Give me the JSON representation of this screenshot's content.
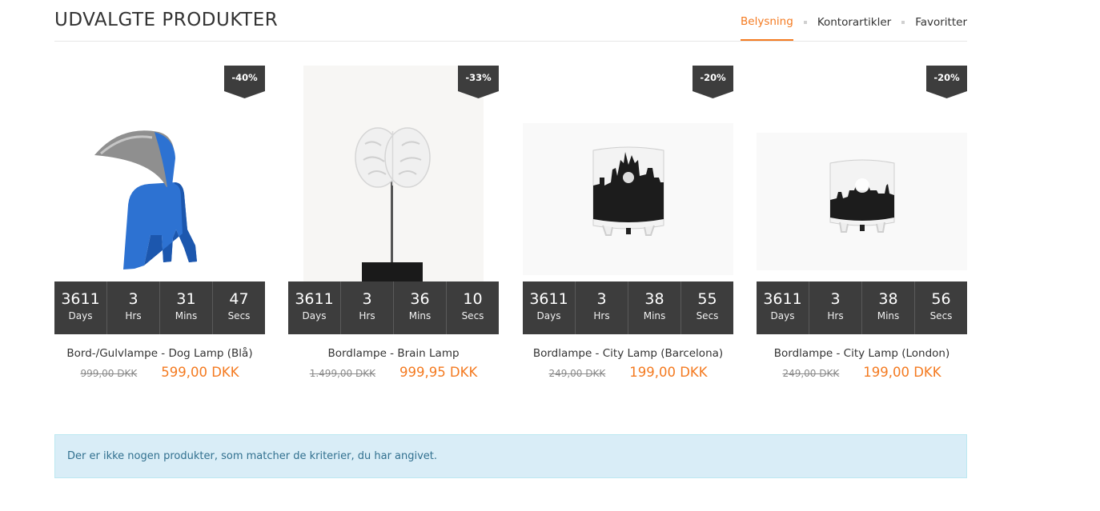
{
  "header": {
    "title": "UDVALGTE PRODUKTER",
    "tabs": [
      {
        "label": "Belysning",
        "active": true
      },
      {
        "label": "Kontorartikler",
        "active": false
      },
      {
        "label": "Favoritter",
        "active": false
      }
    ]
  },
  "timer_units": {
    "days": "Days",
    "hrs": "Hrs",
    "mins": "Mins",
    "secs": "Secs"
  },
  "products": [
    {
      "name": "Bord-/Gulvlampe - Dog Lamp (Blå)",
      "discount": "-40%",
      "old_price": "999,00 DKK",
      "new_price": "599,00 DKK",
      "days": "3611",
      "hrs": "3",
      "mins": "31",
      "secs": "47",
      "image_icon": "dog-lamp"
    },
    {
      "name": "Bordlampe - Brain Lamp",
      "discount": "-33%",
      "old_price": "1.499,00 DKK",
      "new_price": "999,95 DKK",
      "days": "3611",
      "hrs": "3",
      "mins": "36",
      "secs": "10",
      "image_icon": "brain-lamp"
    },
    {
      "name": "Bordlampe - City Lamp (Barcelona)",
      "discount": "-20%",
      "old_price": "249,00 DKK",
      "new_price": "199,00 DKK",
      "days": "3611",
      "hrs": "3",
      "mins": "38",
      "secs": "55",
      "image_icon": "city-lamp"
    },
    {
      "name": "Bordlampe - City Lamp (London)",
      "discount": "-20%",
      "old_price": "249,00 DKK",
      "new_price": "199,00 DKK",
      "days": "3611",
      "hrs": "3",
      "mins": "38",
      "secs": "56",
      "image_icon": "city-lamp"
    }
  ],
  "alert": {
    "text": "Der er ikke nogen produkter, som matcher de kriterier, du har angivet."
  },
  "colors": {
    "accent": "#f47a20",
    "timer_bg": "#3d3d3d",
    "alert_bg": "#d9edf7",
    "alert_text": "#31708f",
    "price_old": "#8a8a8a"
  }
}
